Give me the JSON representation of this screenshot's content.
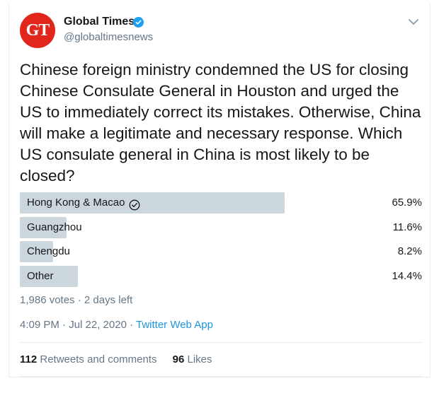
{
  "account": {
    "avatar_text": "GT",
    "name": "Global Times",
    "handle": "@globaltimesnews",
    "verified": true
  },
  "tweet": {
    "text": "Chinese foreign ministry condemned the US for closing Chinese Consulate General in Houston and urged the US to immediately correct its mistakes. Otherwise, China will make a legitimate and necessary response. Which US consulate general in China is most likely to be closed?"
  },
  "poll": {
    "options": [
      {
        "label": "Hong Kong & Macao",
        "percent": "65.9%",
        "fraction": 0.659,
        "winner": true
      },
      {
        "label": "Guangzhou",
        "percent": "11.6%",
        "fraction": 0.116,
        "winner": false
      },
      {
        "label": "Chengdu",
        "percent": "8.2%",
        "fraction": 0.082,
        "winner": false
      },
      {
        "label": "Other",
        "percent": "14.4%",
        "fraction": 0.144,
        "winner": false
      }
    ],
    "meta": "1,986 votes · 2 days left"
  },
  "timestamp": {
    "time": "4:09 PM · Jul 22, 2020 · ",
    "source": "Twitter Web App"
  },
  "stats": {
    "retweets_count": "112",
    "retweets_label": "Retweets and comments",
    "likes_count": "96",
    "likes_label": "Likes"
  },
  "colors": {
    "brand_red": "#e1261c",
    "verified_blue": "#1da1f2",
    "link_blue": "#1b95e0",
    "bar_gray": "#ccd6dd"
  },
  "icons": [
    "verified-badge-icon",
    "chevron-down-icon",
    "checkmark-circle-icon"
  ]
}
